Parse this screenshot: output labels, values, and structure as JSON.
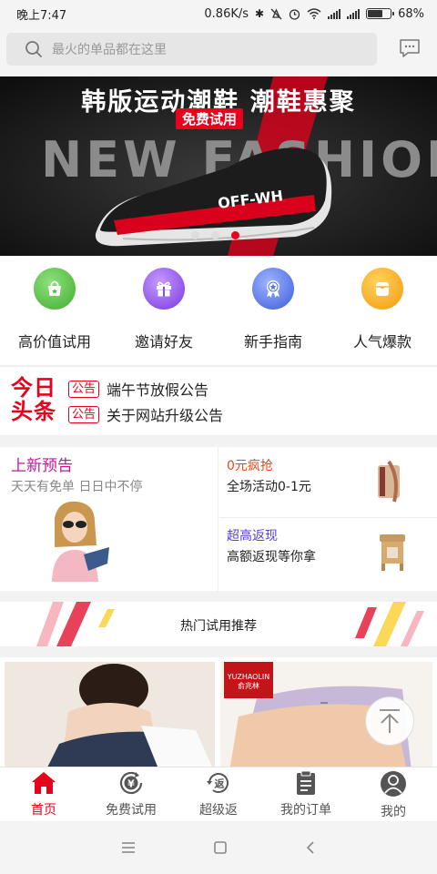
{
  "status_bar": {
    "time": "晚上7:47",
    "network_speed": "0.86K/s",
    "battery_percent": "68%",
    "battery_level": 0.68
  },
  "search": {
    "placeholder": "最火的单品都在这里",
    "icon": "search-icon",
    "message_icon": "chat-bubble-icon"
  },
  "banner": {
    "title": "韩版运动潮鞋 潮鞋惠聚",
    "badge": "免费试用",
    "big_word": "NEW FASHIONE",
    "shoe_label": "OFF-WH",
    "dots_count": 3,
    "active_dot": 3,
    "colors": {
      "accent": "#e8001c",
      "background": "#1a1a1a"
    }
  },
  "quick_menu": [
    {
      "label": "高价值试用",
      "icon": "shopping-bag-icon",
      "color": "#4cbc3e"
    },
    {
      "label": "邀请好友",
      "icon": "gift-icon",
      "color": "#8d4ee8"
    },
    {
      "label": "新手指南",
      "icon": "medal-icon",
      "color": "#4f6fe8"
    },
    {
      "label": "人气爆款",
      "icon": "pocket-icon",
      "color": "#f5a623"
    }
  ],
  "headlines": {
    "logo_line1": "今日",
    "logo_line2": "头条",
    "items": [
      {
        "tag": "公告",
        "text": "端午节放假公告"
      },
      {
        "tag": "公告",
        "text": "关于网站升级公告"
      }
    ]
  },
  "promo": {
    "left": {
      "title": "上新预告",
      "subtitle": "天天有免单 日日中不停",
      "title_color": "#c2179b"
    },
    "top_right": {
      "title": "0元疯抢",
      "subtitle": "全场活动0-1元",
      "title_color": "#e84a0c"
    },
    "bottom_right": {
      "title": "超高返现",
      "subtitle": "高额返现等你拿",
      "title_color": "#5a3fd6"
    }
  },
  "section": {
    "title": "热门试用推荐"
  },
  "products": {
    "brand_name": "YUZHAOLIN",
    "brand_name_cn": "俞兆林"
  },
  "tab_bar": [
    {
      "label": "首页",
      "icon": "home-icon",
      "active": true
    },
    {
      "label": "免费试用",
      "icon": "yen-refresh-icon",
      "active": false
    },
    {
      "label": "超级返",
      "icon": "return-circle-icon",
      "active": false
    },
    {
      "label": "我的订单",
      "icon": "order-list-icon",
      "active": false
    },
    {
      "label": "我的",
      "icon": "user-avatar-icon",
      "active": false
    }
  ],
  "system_nav": [
    "menu-icon",
    "home-square-icon",
    "back-chevron-icon"
  ]
}
